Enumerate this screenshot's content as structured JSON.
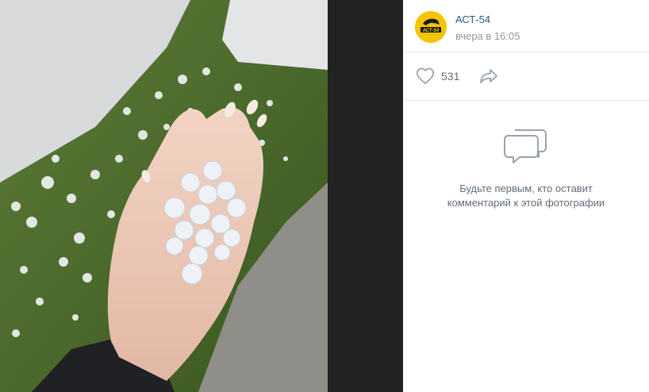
{
  "post": {
    "author": "АСТ-54",
    "avatar_label": "АСТ-54",
    "time": "вчера в 16:05"
  },
  "actions": {
    "like_count": "531",
    "like_icon": "heart-icon",
    "share_icon": "share-arrow-icon"
  },
  "comments": {
    "empty_icon": "comments-icon",
    "empty_line1": "Будьте первым, кто оставит",
    "empty_line2": "комментарий к этой фотографии"
  },
  "colors": {
    "link": "#2a5885",
    "muted": "#939699",
    "avatar_bg": "#f5c400",
    "icon": "#99a2ad"
  }
}
